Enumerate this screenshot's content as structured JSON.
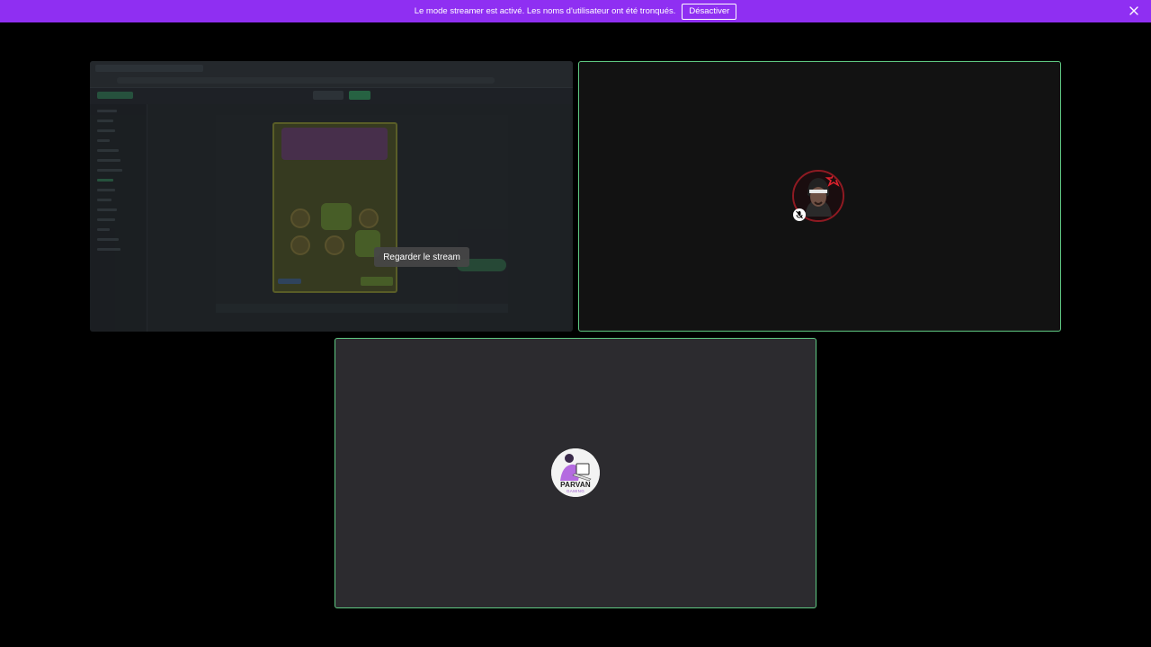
{
  "banner": {
    "message": "Le mode streamer est activé. Les noms d'utilisateur ont été tronqués.",
    "disable_label": "Désactiver",
    "background_color": "#8f2ff2"
  },
  "stream_tile": {
    "watch_label": "Regarder le stream"
  },
  "participant_2": {
    "avatar_text_main": "PARVAN",
    "avatar_text_sub": "GAMING"
  },
  "icons": {
    "close": "close-icon",
    "mute": "microphone-muted-icon"
  },
  "colors": {
    "speaking_border": "#5fc983",
    "page_background": "#000000"
  }
}
